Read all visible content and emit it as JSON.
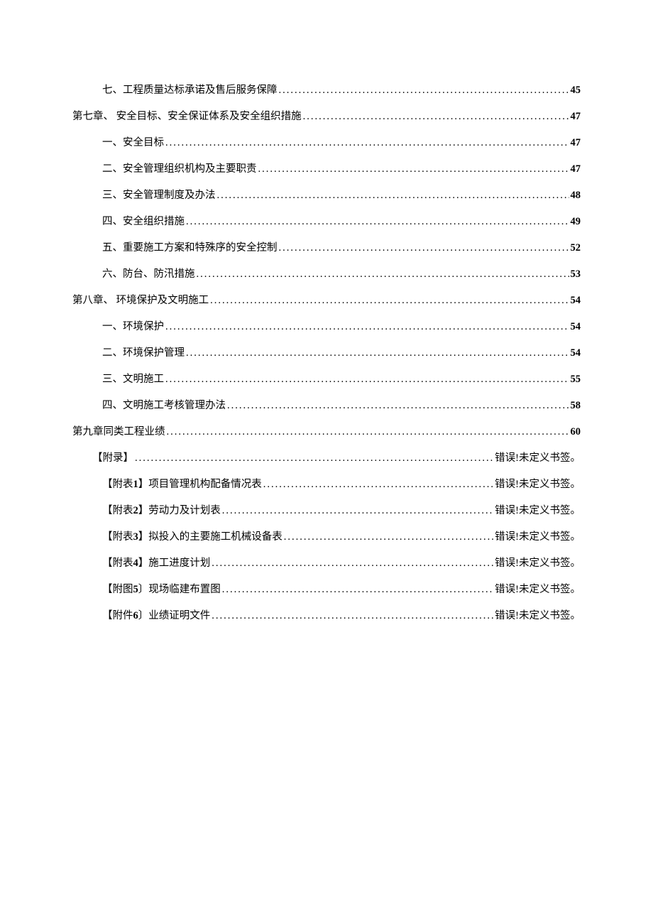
{
  "toc": [
    {
      "indent": 2,
      "label": "七、工程质量达标承诺及售后服务保障",
      "page": "45",
      "err": false
    },
    {
      "indent": 0,
      "label": "第七章、 安全目标、安全保证体系及安全组织措施",
      "page": "47",
      "err": false
    },
    {
      "indent": 2,
      "label": "一、安全目标",
      "page": "47",
      "err": false
    },
    {
      "indent": 2,
      "label": "二、安全管理组织机构及主要职责",
      "page": "47",
      "err": false
    },
    {
      "indent": 2,
      "label": "三、安全管理制度及办法",
      "page": "48",
      "err": false
    },
    {
      "indent": 2,
      "label": "四、安全组织措施",
      "page": "49",
      "err": false
    },
    {
      "indent": 2,
      "label": "五、重要施工方案和特殊序的安全控制",
      "page": "52",
      "err": false
    },
    {
      "indent": 2,
      "label": "六、防台、防汛措施",
      "page": "53",
      "err": false
    },
    {
      "indent": 0,
      "label": "第八章、 环境保护及文明施工",
      "page": "54",
      "err": false
    },
    {
      "indent": 2,
      "label": "一、环境保护",
      "page": "54",
      "err": false
    },
    {
      "indent": 2,
      "label": "二、环境保护管理",
      "page": "54",
      "err": false
    },
    {
      "indent": 2,
      "label": "三、文明施工",
      "page": "55",
      "err": false
    },
    {
      "indent": 2,
      "label": "四、文明施工考核管理办法",
      "page": "58",
      "err": false
    },
    {
      "indent": 0,
      "label": "第九章同类工程业绩",
      "page": "60",
      "err": false
    },
    {
      "indent": 1,
      "label": "【附录】",
      "page": "错误!未定义书签。",
      "err": true
    },
    {
      "indent": 2,
      "labelPre": "【附表",
      "num": "1",
      "labelPost": "】项目管理机构配备情况表",
      "page": "错误!未定义书签。",
      "err": true
    },
    {
      "indent": 2,
      "labelPre": "【附表",
      "num": "2",
      "labelPost": "】劳动力及计划表",
      "page": "错误!未定义书签。",
      "err": true
    },
    {
      "indent": 2,
      "labelPre": "【附表",
      "num": "3",
      "labelPost": "】拟投入的主要施工机械设备表",
      "page": "错误!未定义书签。",
      "err": true
    },
    {
      "indent": 2,
      "labelPre": "【附表",
      "num": "4",
      "labelPost": "】施工进度计划",
      "page": "错误!未定义书签。",
      "err": true
    },
    {
      "indent": 2,
      "labelPre": "【附图",
      "num": "5",
      "labelPost": "〕现场临建布置图",
      "page": "错误!未定义书签。",
      "err": true
    },
    {
      "indent": 2,
      "labelPre": "【附件",
      "num": "6",
      "labelPost": "〕业绩证明文件",
      "page": "错误!未定义书签。",
      "err": true
    }
  ]
}
